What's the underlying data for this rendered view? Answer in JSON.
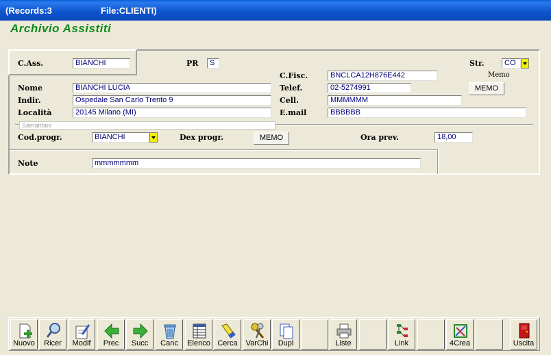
{
  "window": {
    "records": "(Records:3",
    "file": "File:CLIENTI)"
  },
  "app_title": "Archivio Assistiti",
  "form": {
    "cass_label": "C.Ass.",
    "cass_value": "BIANCHI",
    "pr_label": "PR",
    "pr_value": "S",
    "str_label": "Str.",
    "str_value": "CO",
    "cfisc_label": "C.Fisc.",
    "cfisc_value": "BNCLCA12H876E442",
    "memo_label": "Memo",
    "memo_button": "MEMO",
    "nome_label": "Nome",
    "nome_value": "BIANCHI LUCIA",
    "telef_label": "Telef.",
    "telef_value": "02-5274991",
    "indir_label": "Indir.",
    "indir_value": "Ospedale San Carlo  Trento 9",
    "cell_label": "Cell.",
    "cell_value": "MMMMMM",
    "localita_label": "Località",
    "localita_value": "20145  Milano (MI)",
    "email_label": "E.mail",
    "email_value": "BBBBBB",
    "samaritani_value": "Samaritani",
    "codprogr_label": "Cod.progr.",
    "codprogr_value": "BIANCHI",
    "dexprogr_label": "Dex progr.",
    "dexprogr_button": "MEMO",
    "oraprev_label": "Ora prev.",
    "oraprev_value": "18,00",
    "note_label": "Note",
    "note_value": "mmmmmmm"
  },
  "toolbar": {
    "buttons": [
      {
        "label": "Nuovo",
        "icon": "new-document-icon"
      },
      {
        "label": "Ricer",
        "icon": "magnifier-icon"
      },
      {
        "label": "Modif",
        "icon": "edit-document-icon"
      },
      {
        "label": "Prec",
        "icon": "arrow-left-icon"
      },
      {
        "label": "Succ",
        "icon": "arrow-right-icon"
      },
      {
        "label": "Canc",
        "icon": "trash-icon"
      },
      {
        "label": "Elenco",
        "icon": "list-icon"
      },
      {
        "label": "Cerca",
        "icon": "flashlight-icon"
      },
      {
        "label": "VarChi",
        "icon": "keys-icon"
      },
      {
        "label": "Dupl",
        "icon": "duplicate-icon"
      },
      {
        "label": "",
        "icon": ""
      },
      {
        "label": "Liste",
        "icon": "printer-icon"
      },
      {
        "label": "",
        "icon": ""
      },
      {
        "label": "Link",
        "icon": "network-icon"
      },
      {
        "label": "",
        "icon": ""
      },
      {
        "label": "4Crea",
        "icon": "drawing-tools-icon"
      },
      {
        "label": "",
        "icon": ""
      },
      {
        "label": "Uscita",
        "icon": "exit-door-icon"
      }
    ]
  },
  "colors": {
    "title_green": "#0A8A1A",
    "field_text": "#00007A",
    "dropdown_yellow": "#F0F000"
  }
}
